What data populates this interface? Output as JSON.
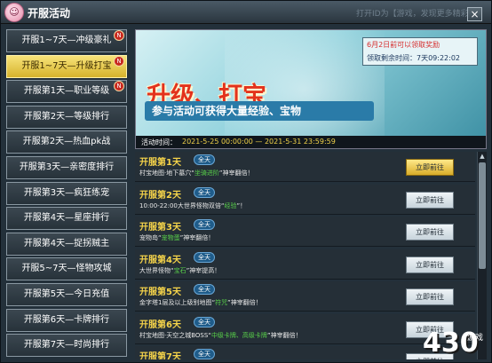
{
  "window": {
    "title": "开服活动",
    "icon_glyph": "☺",
    "watermark": "打开ID为【游戏，发现更多精彩】",
    "close_glyph": "×"
  },
  "sidebar": {
    "items": [
      {
        "label": "开服1~7天—冲级豪礼",
        "badge": "N"
      },
      {
        "label": "开服1~7天—升级打宝",
        "badge": "N"
      },
      {
        "label": "开服第1天—职业等级",
        "badge": "N"
      },
      {
        "label": "开服第2天—等级排行",
        "badge": ""
      },
      {
        "label": "开服第2天—热血pk战",
        "badge": ""
      },
      {
        "label": "开服第3天—亲密度排行",
        "badge": ""
      },
      {
        "label": "开服第3天—疯狂练宠",
        "badge": ""
      },
      {
        "label": "开服第4天—星座排行",
        "badge": ""
      },
      {
        "label": "开服第4天—捉拐贼主",
        "badge": ""
      },
      {
        "label": "开服5~7天—怪物攻城",
        "badge": ""
      },
      {
        "label": "开服第5天—今日充值",
        "badge": ""
      },
      {
        "label": "开服第6天—卡牌排行",
        "badge": ""
      },
      {
        "label": "开服第7天—时尚排行",
        "badge": ""
      }
    ]
  },
  "banner": {
    "title": "升级、打宝",
    "subtitle": "参与活动可获得大量经验、宝物",
    "notice_line1": "6月2日前可以领取奖励",
    "notice_line2_label": "领取剩余时间：",
    "notice_line2_value": "7天09:22:02",
    "time_label": "活动时间：",
    "time_range": "2021-5-25 00:00:00 — 2021-5-31 23:59:59"
  },
  "list": {
    "rows": [
      {
        "day": "开服第1天",
        "tag": "全天",
        "desc_pre": "村宝地图·地下墓穴“",
        "desc_hl": "坐骑进阶",
        "desc_post": "”神宰翻倍！",
        "button": "立即前往",
        "active": true
      },
      {
        "day": "开服第2天",
        "tag": "全天",
        "desc_pre": "10:00-22:00大世界怪物双倍“",
        "desc_hl": "经验",
        "desc_post": "”！",
        "button": "立即前往",
        "active": false
      },
      {
        "day": "开服第3天",
        "tag": "全天",
        "desc_pre": "宠物岛“",
        "desc_hl": "宠物蛋",
        "desc_post": "”神宰翻倍！",
        "button": "立即前往",
        "active": false
      },
      {
        "day": "开服第4天",
        "tag": "全天",
        "desc_pre": "大世界怪物“",
        "desc_hl": "宝石",
        "desc_post": "”神宰提高！",
        "button": "立即前往",
        "active": false
      },
      {
        "day": "开服第5天",
        "tag": "全天",
        "desc_pre": "金字塔1层及以上级别地图“",
        "desc_hl": "符咒",
        "desc_post": "”神宰翻倍！",
        "button": "立即前往",
        "active": false
      },
      {
        "day": "开服第6天",
        "tag": "全天",
        "desc_pre": "村宝地图·天空之城BOSS“",
        "desc_hl": "中级卡牌、高级卡牌",
        "desc_post": "”神宰翻倍！",
        "button": "立即前往",
        "active": false
      },
      {
        "day": "开服第7天",
        "tag": "全天",
        "desc_pre": "",
        "desc_hl": "",
        "desc_post": "",
        "button": "立即前往",
        "active": false
      }
    ]
  },
  "logo": {
    "main": "430",
    "sub": "游戏"
  },
  "colors": {
    "accent_gold": "#f7d54a",
    "banner_red": "#e3321c",
    "highlight_green": "#59d24a",
    "notice_red": "#d62a2a"
  }
}
